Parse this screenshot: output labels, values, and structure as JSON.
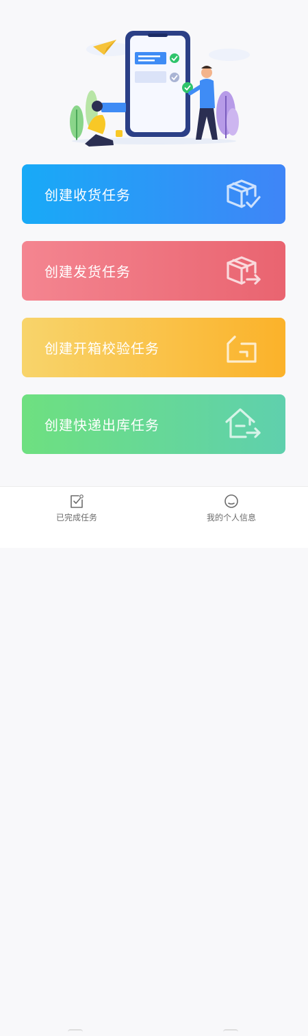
{
  "tasks": [
    {
      "label": "创建收货任务",
      "icon": "box-check-icon"
    },
    {
      "label": "创建发货任务",
      "icon": "box-arrow-icon"
    },
    {
      "label": "创建开箱校验任务",
      "icon": "open-box-icon"
    },
    {
      "label": "创建快递出库任务",
      "icon": "house-arrow-icon"
    }
  ],
  "tabbar": {
    "left": {
      "label": "已完成任务",
      "icon": "checklist-icon"
    },
    "right": {
      "label": "我的个人信息",
      "icon": "user-icon"
    }
  },
  "colors": {
    "receive": "#3f85f7",
    "ship": "#e96470",
    "inspect": "#fbb22a",
    "express": "#5fd0ad"
  }
}
